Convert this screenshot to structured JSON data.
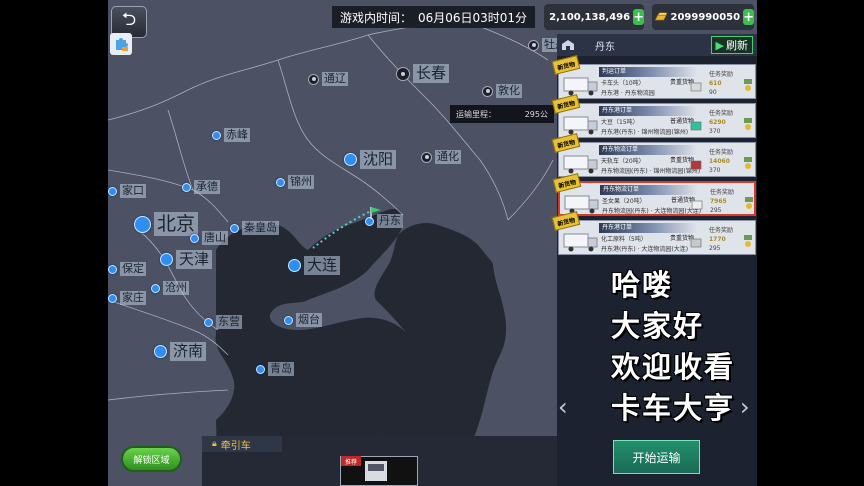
{
  "hud": {
    "time_label": "游戏内时间：",
    "time_value": "06月06日03时01分",
    "money": "2,100,138,496",
    "gold": "2099990050"
  },
  "map": {
    "distance_label": "运输里程：",
    "distance_value": "295公",
    "cities": [
      {
        "name": "长春",
        "size": "big",
        "kind": "poi"
      },
      {
        "name": "通辽",
        "size": "small",
        "kind": "poi"
      },
      {
        "name": "敦化",
        "size": "small",
        "kind": "poi"
      },
      {
        "name": "牡丹",
        "size": "small",
        "kind": "poi"
      },
      {
        "name": "赤峰",
        "size": "small",
        "kind": "dot"
      },
      {
        "name": "沈阳",
        "size": "big",
        "kind": "dot"
      },
      {
        "name": "通化",
        "size": "small",
        "kind": "poi"
      },
      {
        "name": "锦州",
        "size": "small",
        "kind": "dot"
      },
      {
        "name": "承德",
        "size": "small",
        "kind": "dot"
      },
      {
        "name": "家口",
        "size": "small",
        "kind": "dot"
      },
      {
        "name": "北京",
        "size": "huge",
        "kind": "dot"
      },
      {
        "name": "秦皇岛",
        "size": "small",
        "kind": "dot"
      },
      {
        "name": "唐山",
        "size": "small",
        "kind": "dot"
      },
      {
        "name": "丹东",
        "size": "small",
        "kind": "dot"
      },
      {
        "name": "天津",
        "size": "big",
        "kind": "dot"
      },
      {
        "name": "大连",
        "size": "big",
        "kind": "dot"
      },
      {
        "name": "保定",
        "size": "small",
        "kind": "dot"
      },
      {
        "name": "沧州",
        "size": "small",
        "kind": "dot"
      },
      {
        "name": "家庄",
        "size": "small",
        "kind": "dot"
      },
      {
        "name": "东营",
        "size": "small",
        "kind": "dot"
      },
      {
        "name": "烟台",
        "size": "small",
        "kind": "dot"
      },
      {
        "name": "济南",
        "size": "big",
        "kind": "dot"
      },
      {
        "name": "青岛",
        "size": "small",
        "kind": "dot"
      }
    ]
  },
  "panel": {
    "title": "丹东",
    "refresh_label": "刷新",
    "orders": [
      {
        "tag": "新货物",
        "header": "判运订单",
        "truck": "半挂车",
        "line1": "卡车头（10吨）",
        "line2": "丹东港 · 丹东物流园",
        "cargo": "贵重货物",
        "reward_label": "任务奖励",
        "reward1": "610",
        "reward2": "90",
        "cargo_color": "#d9d9d9"
      },
      {
        "tag": "新货物",
        "header": "丹东港订单",
        "truck": "厢式车",
        "line1": "大豆（15吨）",
        "line2": "丹东港(丹东) · 锦州物流园(锦州)",
        "cargo": "普通货物",
        "reward_label": "任务奖励",
        "reward1": "6290",
        "reward2": "370",
        "cargo_color": "#2fc39a"
      },
      {
        "tag": "新货物",
        "header": "丹东物流订单",
        "truck": "平板车",
        "line1": "天轨车（20吨）",
        "line2": "丹东物流园(丹东) · 锦州物流园(锦州)",
        "cargo": "贵重货物",
        "reward_label": "任务奖励",
        "reward1": "14060",
        "reward2": "370",
        "cargo_color": "#b5373a"
      },
      {
        "tag": "新货物",
        "header": "丹东物流订单",
        "truck": "冷藏车",
        "line1": "圣女果（20吨）",
        "line2": "丹东物流园(丹东) · 大连物流园(大连)",
        "cargo": "普通货物",
        "reward_label": "任务奖励",
        "reward1": "7965",
        "reward2": "295",
        "cargo_color": "#eeeeee"
      },
      {
        "tag": "新货物",
        "header": "丹东港订单",
        "truck": "罐式车",
        "line1": "化工原料（5吨）",
        "line2": "丹东港(丹东) · 大连物流园(大连)",
        "cargo": "贵重货物",
        "reward_label": "任务奖励",
        "reward1": "1770",
        "reward2": "295",
        "cargo_color": "#c9c9c9"
      }
    ],
    "start_label": "开始运输"
  },
  "overlay": {
    "lines": [
      "哈喽",
      "大家好",
      "欢迎收看",
      "卡车大亨"
    ]
  },
  "bottom": {
    "unlock_label": "解锁区域",
    "tractor_label": "牵引车",
    "recommend_tag": "推荐"
  }
}
